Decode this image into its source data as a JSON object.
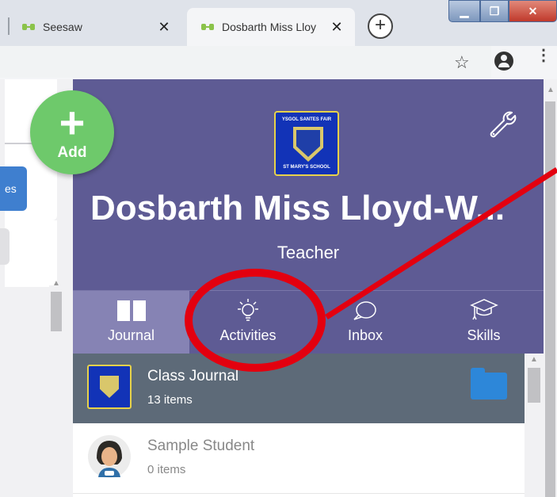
{
  "browser": {
    "tabs": [
      {
        "title": "Seesaw",
        "close": "✕",
        "active": false
      },
      {
        "title": "Dosbarth Miss Lloy",
        "close": "✕",
        "active": true
      }
    ],
    "new_tab": "+",
    "window_controls": {
      "minimize": "▁",
      "maximize": "❐",
      "close": "✕"
    },
    "star_icon": "☆",
    "menu_icon": "⋮"
  },
  "sidebar": {
    "partial_button_label": "es"
  },
  "add_button": {
    "icon": "+",
    "label": "Add"
  },
  "class_header": {
    "crest_top_text": "YSGOL SANTES FAIR",
    "crest_bottom_text": "ST MARY'S SCHOOL",
    "class_name": "Dosbarth Miss Lloyd-W...",
    "role": "Teacher",
    "settings_icon": "wrench-icon"
  },
  "nav": {
    "items": [
      {
        "label": "Journal",
        "icon": "book-icon",
        "active": true
      },
      {
        "label": "Activities",
        "icon": "lightbulb-icon",
        "active": false
      },
      {
        "label": "Inbox",
        "icon": "speech-bubble-icon",
        "active": false
      },
      {
        "label": "Skills",
        "icon": "graduation-cap-icon",
        "active": false
      }
    ]
  },
  "journal_list": {
    "rows": [
      {
        "title": "Class Journal",
        "count": "13 items",
        "selected": true
      },
      {
        "title": "Sample Student",
        "count": "0 items",
        "selected": false
      }
    ]
  },
  "colors": {
    "header_bg": "#5e5b94",
    "nav_active_bg": "#8683b4",
    "selected_row_bg": "#5d6a78",
    "add_button": "#6ec96b",
    "folder_blue": "#2d87d9",
    "annotation_red": "#e3000f"
  }
}
